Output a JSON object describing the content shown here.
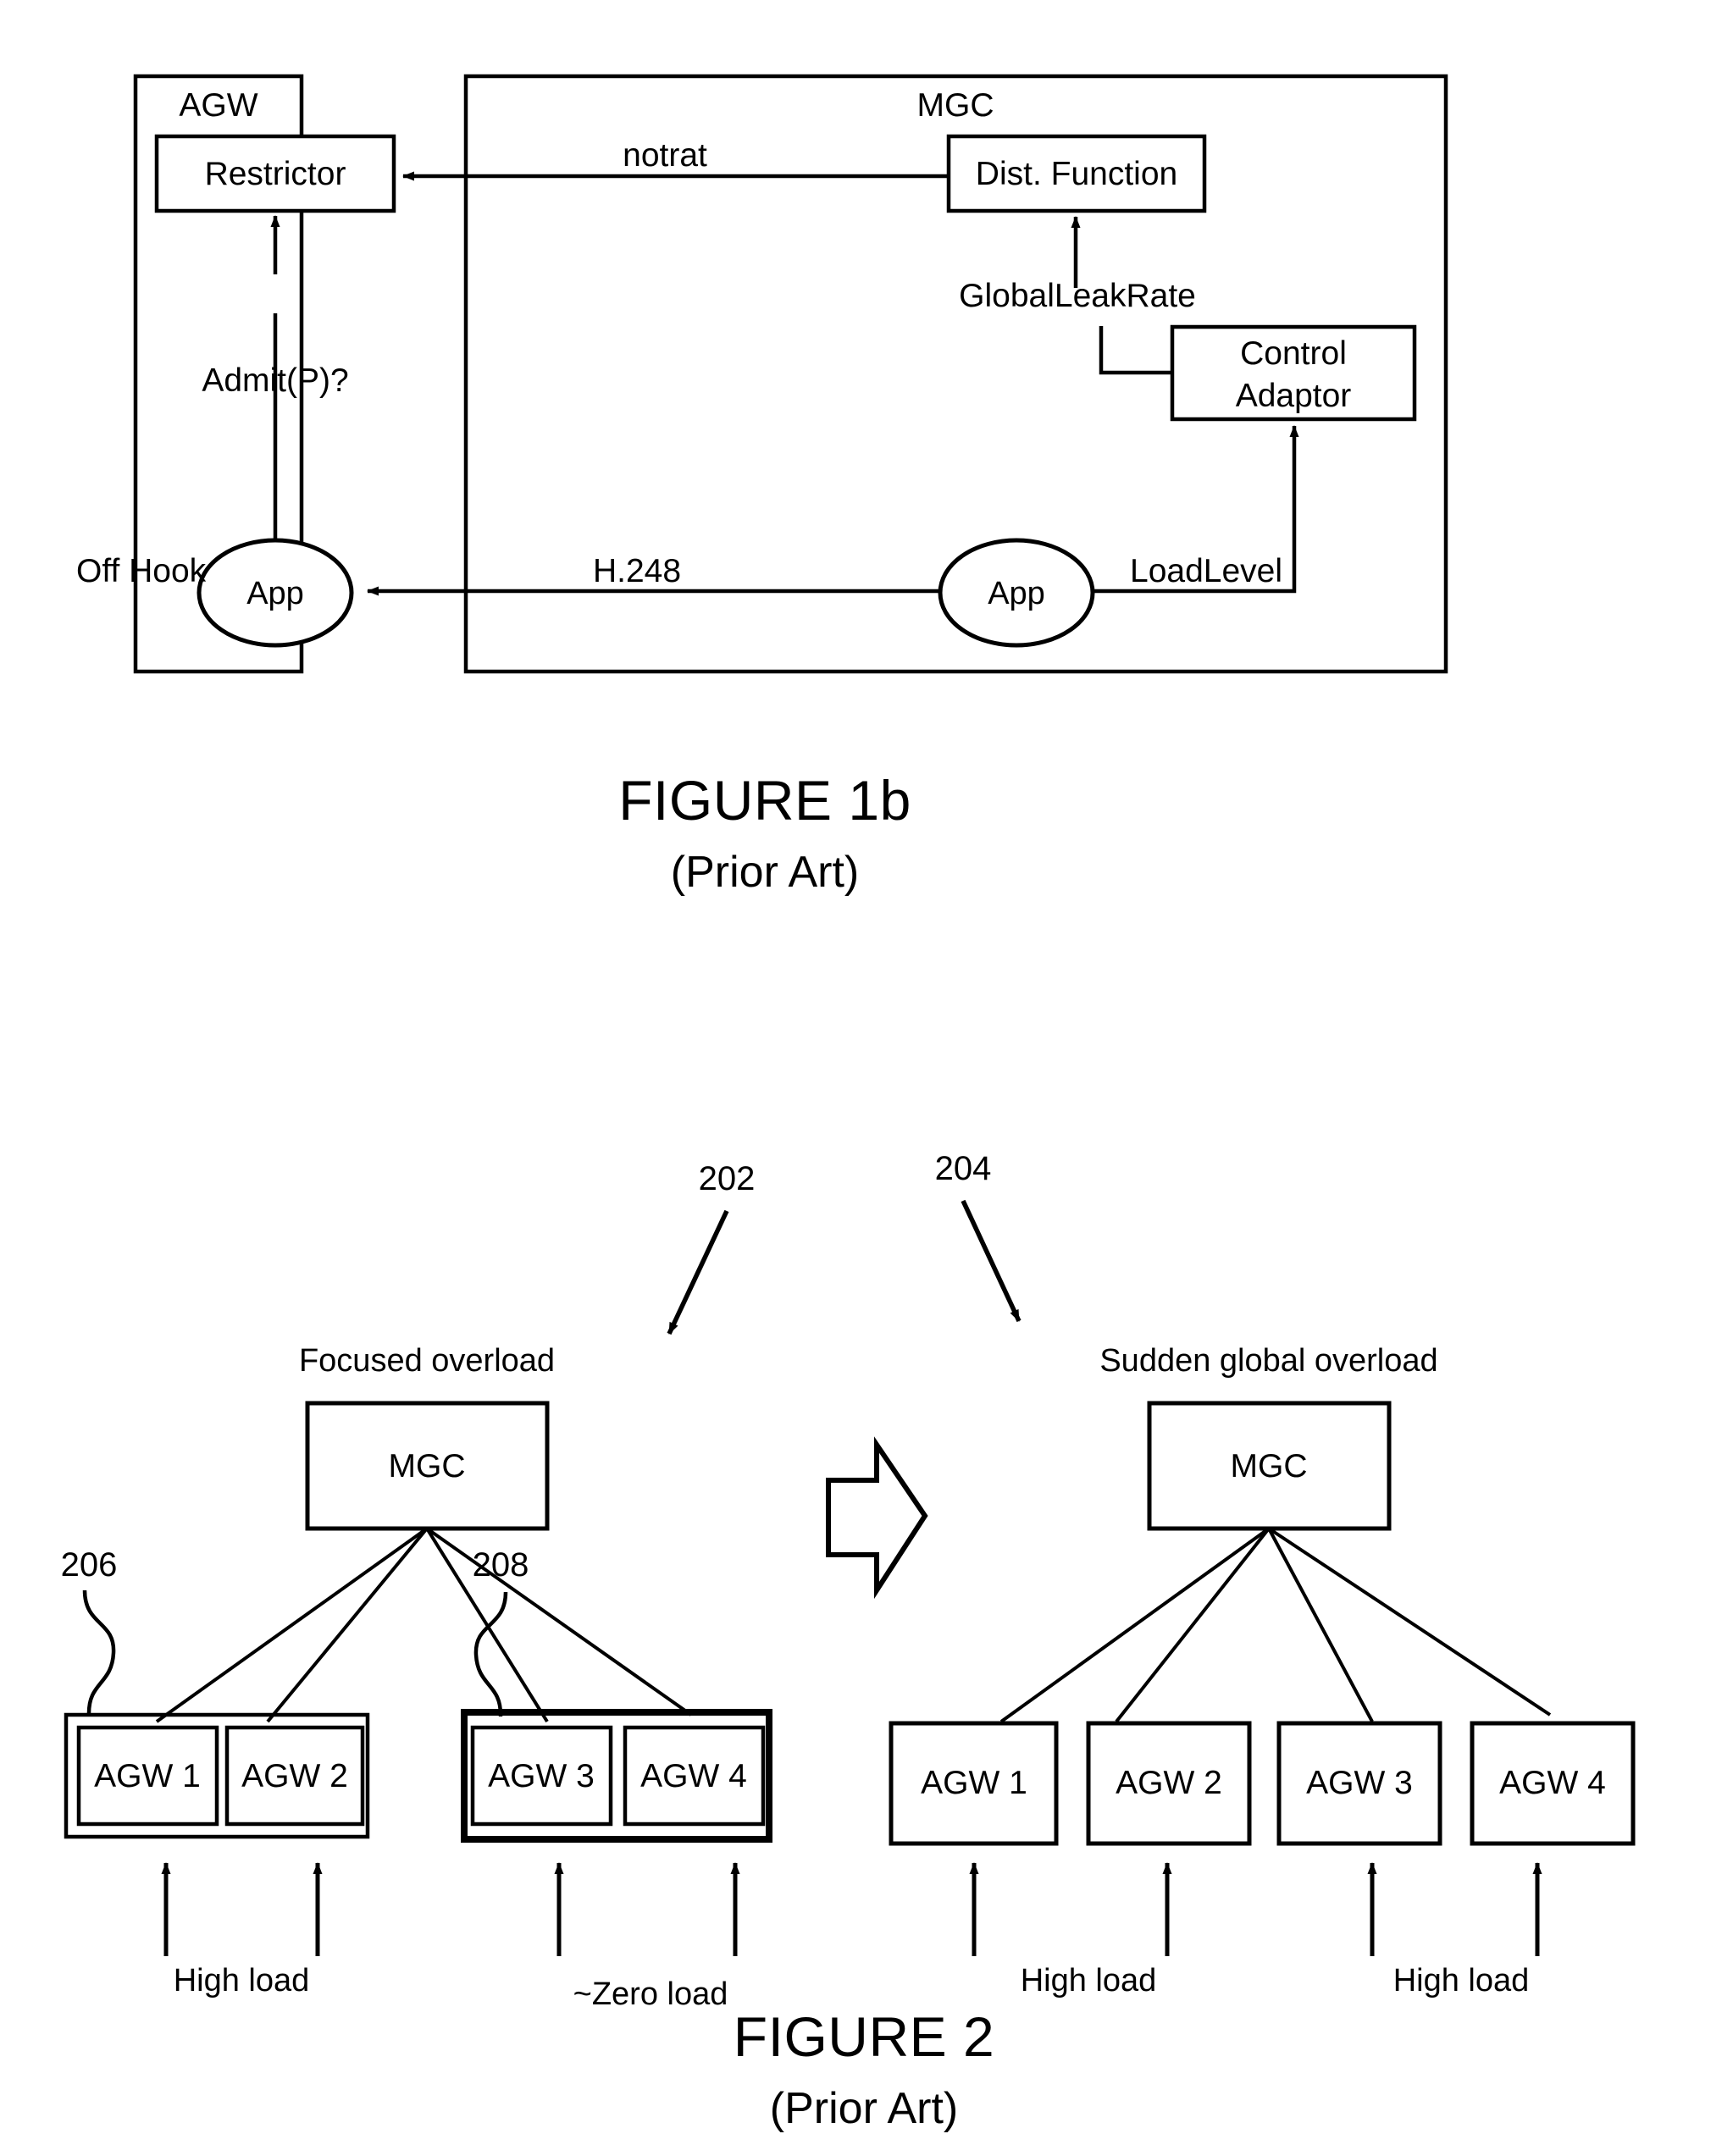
{
  "figure1b": {
    "caption": "FIGURE 1b",
    "caption_sub": "(Prior Art)",
    "left_container_label": "AGW",
    "right_container_label": "MGC",
    "boxes": {
      "restrictor": "Restrictor",
      "dist_function": "Dist. Function",
      "control_adaptor_line1": "Control",
      "control_adaptor_line2": "Adaptor"
    },
    "nodes": {
      "agw_app": "App",
      "mgc_app": "App"
    },
    "edge_labels": {
      "notrat": "notrat",
      "admit": "Admit(P)?",
      "global_leak_rate": "GlobalLeakRate",
      "load_level": "LoadLevel",
      "h248": "H.248",
      "off_hook": "Off Hook"
    }
  },
  "figure2": {
    "caption": "FIGURE 2",
    "caption_sub": "(Prior Art)",
    "refs": {
      "left_panel": "202",
      "right_panel": "204",
      "group_high": "206",
      "group_zero": "208"
    },
    "left_panel": {
      "title": "Focused overload",
      "controller": "MGC",
      "gateways": [
        "AGW 1",
        "AGW 2",
        "AGW 3",
        "AGW 4"
      ],
      "load_labels": [
        "High load",
        "~Zero load"
      ]
    },
    "right_panel": {
      "title": "Sudden global overload",
      "controller": "MGC",
      "gateways": [
        "AGW 1",
        "AGW 2",
        "AGW 3",
        "AGW 4"
      ],
      "load_labels": [
        "High load",
        "High load"
      ]
    }
  },
  "colors": {
    "ink": "#000000",
    "paper": "#ffffff"
  }
}
